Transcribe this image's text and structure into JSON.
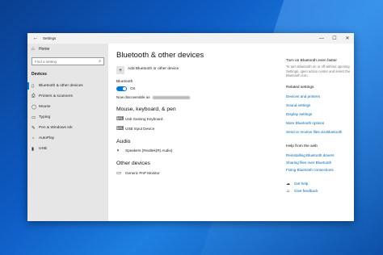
{
  "window": {
    "title": "Settings",
    "controls": {
      "minimize": "—",
      "maximize": "☐",
      "close": "✕"
    }
  },
  "sidebar": {
    "home_label": "Home",
    "search_placeholder": "Find a setting",
    "section_title": "Devices",
    "items": [
      {
        "label": "Bluetooth & other devices",
        "icon": "bluetooth-icon",
        "active": true
      },
      {
        "label": "Printers & scanners",
        "icon": "printer-icon",
        "active": false
      },
      {
        "label": "Mouse",
        "icon": "mouse-icon",
        "active": false
      },
      {
        "label": "Typing",
        "icon": "keyboard-icon",
        "active": false
      },
      {
        "label": "Pen & Windows Ink",
        "icon": "pen-icon",
        "active": false
      },
      {
        "label": "AutoPlay",
        "icon": "autoplay-icon",
        "active": false
      },
      {
        "label": "USB",
        "icon": "usb-icon",
        "active": false
      }
    ]
  },
  "main": {
    "title": "Bluetooth & other devices",
    "add_device_label": "Add Bluetooth or other device",
    "bluetooth_label": "Bluetooth",
    "toggle_state": "On",
    "discoverable_label": "Now discoverable as",
    "groups": [
      {
        "title": "Mouse, keyboard, & pen",
        "devices": [
          {
            "name": "Usb Gaming Keyboard",
            "icon": "keyboard-icon"
          },
          {
            "name": "USB Input Device",
            "icon": "keyboard-icon"
          }
        ]
      },
      {
        "title": "Audio",
        "devices": [
          {
            "name": "Speakers (Realtek(R) Audio)",
            "icon": "speaker-icon"
          }
        ]
      },
      {
        "title": "Other devices",
        "devices": [
          {
            "name": "Generic PnP Monitor",
            "icon": "monitor-icon"
          }
        ]
      }
    ]
  },
  "related": {
    "tip_title": "Turn on Bluetooth even faster",
    "tip_text": "To turn Bluetooth on or off without opening Settings, open action center and select the Bluetooth icon.",
    "related_title": "Related settings",
    "related_links": [
      "Devices and printers",
      "Sound settings",
      "Display settings",
      "More Bluetooth options",
      "Send or receive files via Bluetooth"
    ],
    "help_title": "Help from the web",
    "help_links": [
      "Reinstalling Bluetooth drivers",
      "Sharing files over Bluetooth",
      "Fixing Bluetooth connections"
    ],
    "get_help": "Get help",
    "give_feedback": "Give feedback"
  },
  "colors": {
    "accent": "#0078d7",
    "link": "#0066b4",
    "sidebar_bg": "#e6e6e6",
    "desktop": "#0d5bc4"
  }
}
